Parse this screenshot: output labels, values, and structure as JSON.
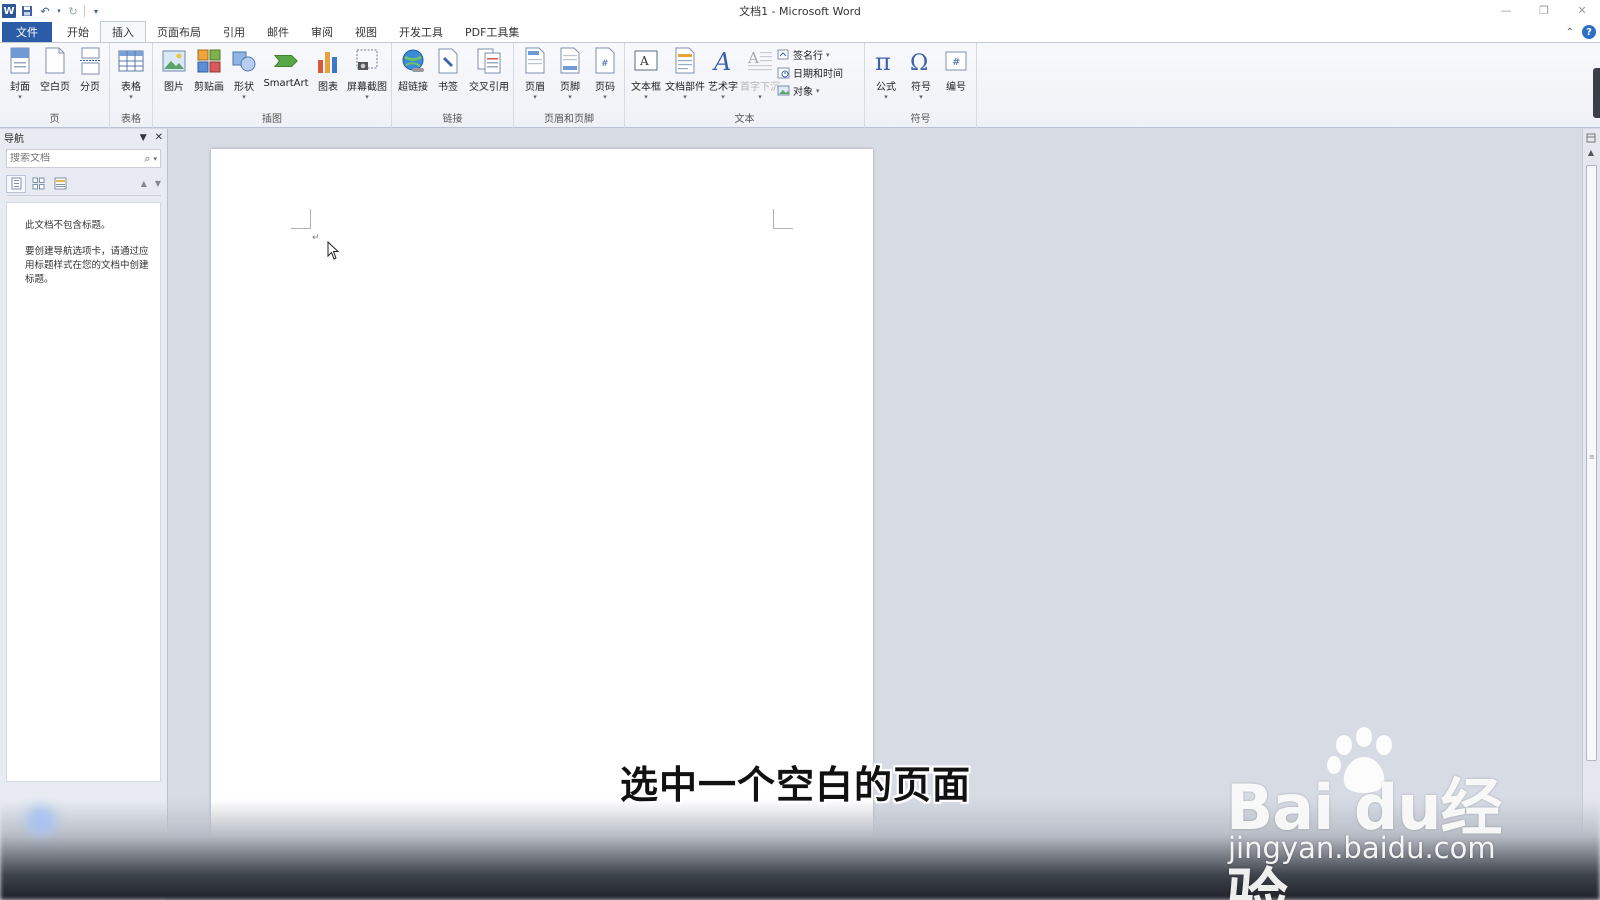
{
  "window": {
    "title": "文档1 - Microsoft Word"
  },
  "tabs": [
    {
      "label": "文件"
    },
    {
      "label": "开始"
    },
    {
      "label": "插入"
    },
    {
      "label": "页面布局"
    },
    {
      "label": "引用"
    },
    {
      "label": "邮件"
    },
    {
      "label": "审阅"
    },
    {
      "label": "视图"
    },
    {
      "label": "开发工具"
    },
    {
      "label": "PDF工具集"
    }
  ],
  "ribbon": {
    "groups": {
      "pages": "页",
      "tables": "表格",
      "illustrations": "插图",
      "links": "链接",
      "header_footer": "页眉和页脚",
      "text": "文本",
      "symbols": "符号"
    },
    "buttons": {
      "cover": "封面",
      "blank_page": "空白页",
      "page_break": "分页",
      "table": "表格",
      "picture": "图片",
      "clip_art": "剪贴画",
      "shapes": "形状",
      "smartart": "SmartArt",
      "chart": "图表",
      "screenshot": "屏幕截图",
      "hyperlink": "超链接",
      "bookmark": "书签",
      "cross_ref": "交叉引用",
      "header": "页眉",
      "footer": "页脚",
      "page_number": "页码",
      "text_box": "文本框",
      "quick_parts": "文档部件",
      "wordart": "艺术字",
      "drop_cap": "首字下沉",
      "signature_line": "签名行",
      "date_time": "日期和时间",
      "object": "对象",
      "equation": "公式",
      "symbol": "符号",
      "numbering": "编号"
    }
  },
  "nav": {
    "title": "导航",
    "search_placeholder": "搜索文档",
    "msg1": "此文档不包含标题。",
    "msg2": "要创建导航选项卡，请通过应用标题样式在您的文档中创建标题。"
  },
  "subtitle": "选中一个空白的页面",
  "watermark": {
    "logo": "Bai  du经验",
    "url": "jingyan.baidu.com"
  },
  "colors": {
    "file_tab": "#2b5ca8",
    "doc_bg": "#d6dbe4",
    "ribbon_bg": "#f3f5f9"
  }
}
